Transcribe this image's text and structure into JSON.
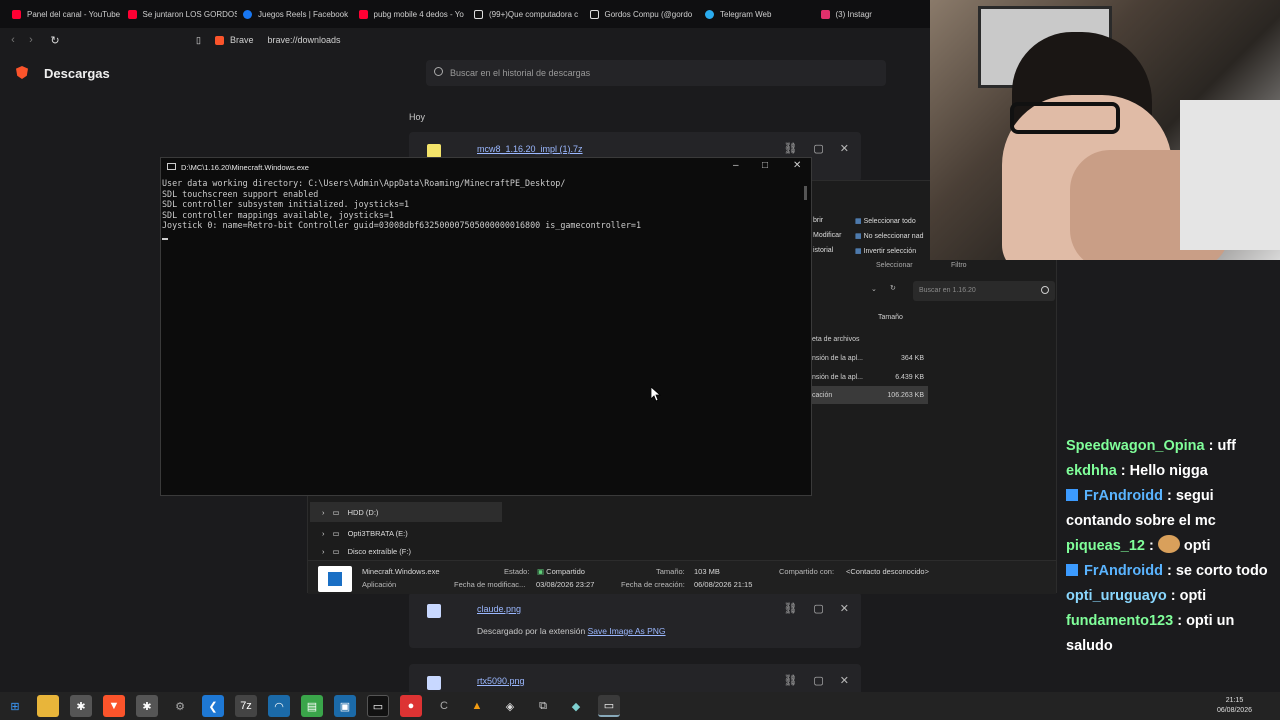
{
  "tabs": [
    {
      "label": "Panel del canal - YouTube",
      "icon": "youtube-icon",
      "color": "#ff0033"
    },
    {
      "label": "Se juntaron LOS GORDOS",
      "icon": "youtube-icon",
      "color": "#ff0033"
    },
    {
      "label": "Juegos Reels | Facebook",
      "icon": "facebook-icon",
      "color": "#1877f2"
    },
    {
      "label": "pubg mobile 4 dedos - Yo",
      "icon": "youtube-icon",
      "color": "#ff0033"
    },
    {
      "label": "(99+)Que computadora c",
      "icon": "tiktok-icon",
      "color": "#ffffff"
    },
    {
      "label": "Gordos Compu (@gordo",
      "icon": "tiktok-icon",
      "color": "#ffffff"
    },
    {
      "label": "Telegram Web",
      "icon": "telegram-icon",
      "color": "#2aabee"
    },
    {
      "label": "(3) Instagr",
      "icon": "instagram-icon",
      "color": "#e1306c"
    }
  ],
  "address": {
    "brand": "Brave",
    "url": "brave://downloads"
  },
  "downloads": {
    "title": "Descargas",
    "search_placeholder": "Buscar en el historial de descargas",
    "section": "Hoy",
    "items": [
      {
        "name": "mcw8_1.16.20_impl (1).7z"
      },
      {
        "name": "claude.png",
        "note_prefix": "Descargado por la extensión",
        "note_link": "Save Image As PNG"
      },
      {
        "name": "rtx5090.png"
      }
    ]
  },
  "explorer": {
    "ribbon": {
      "open": "brir",
      "modify": "Modificar",
      "history": "istorial",
      "select_all": "Seleccionar todo",
      "select_none": "No seleccionar nad",
      "invert": "Invertir selección",
      "group_select": "Seleccionar",
      "group_filter": "Filtro"
    },
    "search_placeholder": "Buscar en 1.16.20",
    "col_size": "Tamaño",
    "rows": [
      {
        "type": "eta de archivos",
        "size": ""
      },
      {
        "type": "nsión de la apl...",
        "size": "364 KB"
      },
      {
        "type": "nsión de la apl...",
        "size": "6.439 KB"
      },
      {
        "type": "cación",
        "size": "106.263 KB"
      }
    ],
    "tree": [
      {
        "label": "HDD (D:)"
      },
      {
        "label": "Opti3TBRATA (E:)"
      },
      {
        "label": "Disco extraíble (F:)"
      }
    ],
    "details": {
      "name": "Minecraft.Windows.exe",
      "kind": "Aplicación",
      "state_label": "Estado:",
      "state_value": "Compartido",
      "modified_label": "Fecha de modificac...",
      "modified_value": "03/08/2026 23:27",
      "size_label": "Tamaño:",
      "size_value": "103 MB",
      "created_label": "Fecha de creación:",
      "created_value": "06/08/2026 21:15",
      "shared_label": "Compartido con:",
      "shared_value": "<Contacto desconocido>"
    }
  },
  "console": {
    "title": "D:\\MC\\1.16.20\\Minecraft.Windows.exe",
    "lines": [
      "User data working directory: C:\\Users\\Admin\\AppData\\Roaming/MinecraftPE_Desktop/",
      "SDL touchscreen support enabled",
      "SDL controller subsystem initialized. joysticks=1",
      "SDL controller mappings available, joysticks=1",
      "Joystick 0: name=Retro-bit Controller guid=03008dbf632500007505000000016800 is_gamecontroller=1"
    ]
  },
  "chat": [
    {
      "user": "Speedwagon_Opina",
      "text": "uff",
      "badge": false
    },
    {
      "user": "ekdhha",
      "text": "Hello nigga",
      "badge": false
    },
    {
      "user": "FrAndroidd",
      "text": "segui contando sobre el mc",
      "badge": true
    },
    {
      "user": "piqueas_12",
      "text": "opti",
      "badge": false
    },
    {
      "user": "FrAndroidd",
      "text": "se corto todo",
      "badge": true
    },
    {
      "user": "opti_uruguayo",
      "text": "opti",
      "badge": false
    },
    {
      "user": "fundamento123",
      "text": "opti un saludo",
      "badge": false
    }
  ],
  "clock": {
    "time": "21:15",
    "date": "06/08/2026"
  }
}
